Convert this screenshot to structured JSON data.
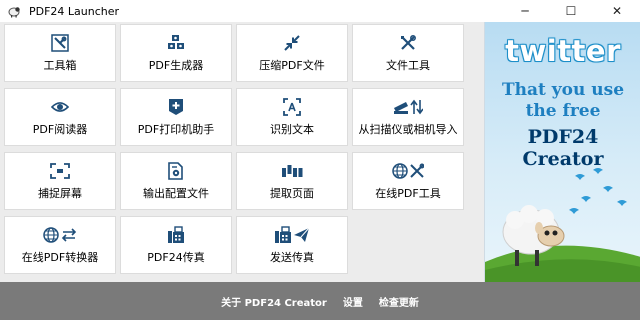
{
  "window": {
    "title": "PDF24 Launcher",
    "minimize_glyph": "─",
    "maximize_glyph": "☐",
    "close_glyph": "✕"
  },
  "tools": [
    {
      "label": "工具箱",
      "icon": "toolbox-icon"
    },
    {
      "label": "PDF生成器",
      "icon": "pdf-creator-icon"
    },
    {
      "label": "压缩PDF文件",
      "icon": "compress-icon"
    },
    {
      "label": "文件工具",
      "icon": "file-tools-icon"
    },
    {
      "label": "PDF阅读器",
      "icon": "eye-icon"
    },
    {
      "label": "PDF打印机助手",
      "icon": "printer-assistant-icon"
    },
    {
      "label": "识别文本",
      "icon": "ocr-icon"
    },
    {
      "label": "从扫描仪或相机导入",
      "icon": "scanner-import-icon"
    },
    {
      "label": "捕捉屏幕",
      "icon": "screen-capture-icon"
    },
    {
      "label": "输出配置文件",
      "icon": "output-profile-icon"
    },
    {
      "label": "提取页面",
      "icon": "extract-pages-icon"
    },
    {
      "label": "在线PDF工具",
      "icon": "online-tools-icon"
    },
    {
      "label": "在线PDF转换器",
      "icon": "online-converter-icon"
    },
    {
      "label": "PDF24传真",
      "icon": "fax-icon"
    },
    {
      "label": "发送传真",
      "icon": "send-fax-icon"
    }
  ],
  "ad": {
    "logo_text": "twitter",
    "line1": "That you use",
    "line2": "the free",
    "product": "PDF24 Creator"
  },
  "footer": {
    "about": "关于 PDF24 Creator",
    "settings": "设置",
    "check_updates": "检查更新"
  },
  "colors": {
    "icon_blue": "#1f4e79",
    "twitter_blue": "#1d8fc9",
    "footer_bg": "#7a7a7a",
    "grass": "#5aa832"
  }
}
